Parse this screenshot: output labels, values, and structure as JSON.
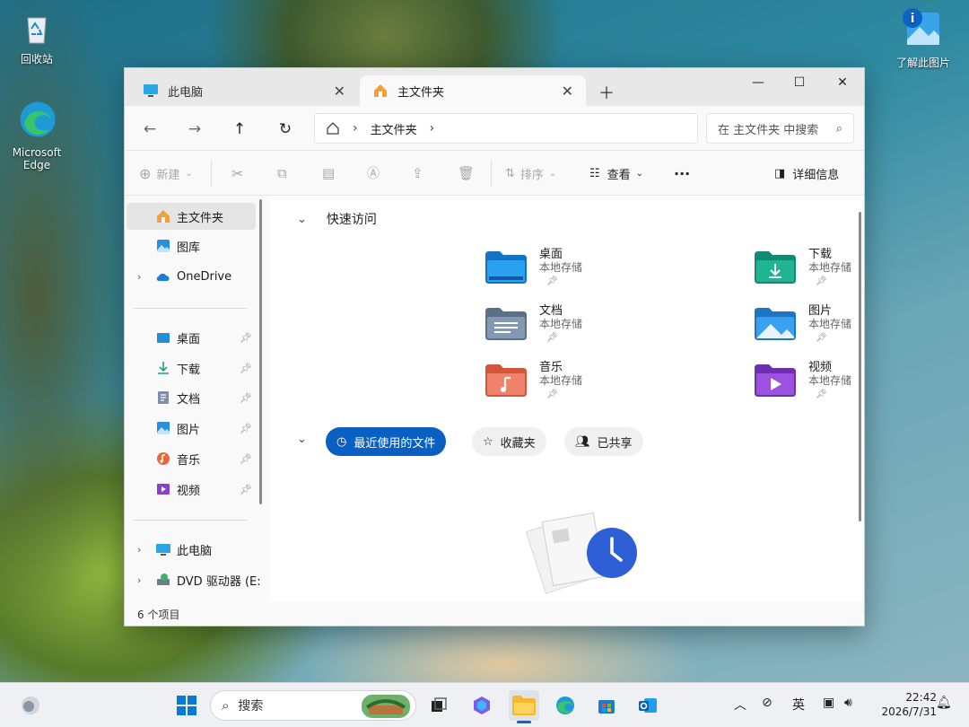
{
  "desktop": {
    "recycle_bin": "回收站",
    "edge_line1": "Microsoft",
    "edge_line2": "Edge",
    "spotlight": "了解此图片"
  },
  "window": {
    "tabs": [
      {
        "label": "此电脑",
        "icon": "monitor-icon"
      },
      {
        "label": "主文件夹",
        "icon": "home-icon"
      }
    ],
    "breadcrumb": [
      "主文件夹"
    ],
    "search_placeholder": "在 主文件夹 中搜索",
    "commands": {
      "new": "新建",
      "sort": "排序",
      "view": "查看",
      "details": "详细信息"
    },
    "sidebar": {
      "top": [
        {
          "label": "主文件夹",
          "icon": "home-icon"
        },
        {
          "label": "图库",
          "icon": "gallery-icon"
        },
        {
          "label": "OneDrive",
          "icon": "cloud-icon"
        }
      ],
      "pinned": [
        {
          "label": "桌面",
          "icon": "desktop-icon"
        },
        {
          "label": "下载",
          "icon": "download-icon"
        },
        {
          "label": "文档",
          "icon": "document-icon"
        },
        {
          "label": "图片",
          "icon": "picture-icon"
        },
        {
          "label": "音乐",
          "icon": "music-icon"
        },
        {
          "label": "视频",
          "icon": "video-icon"
        }
      ],
      "devices": [
        {
          "label": "此电脑",
          "icon": "monitor-icon"
        },
        {
          "label": "DVD 驱动器 (E:",
          "icon": "dvd-icon"
        }
      ]
    },
    "quick_access": {
      "title": "快速访问",
      "items": [
        {
          "name": "桌面",
          "sub": "本地存储",
          "color": "#1e8fd8"
        },
        {
          "name": "下载",
          "sub": "本地存储",
          "color": "#1aa58a"
        },
        {
          "name": "文档",
          "sub": "本地存储",
          "color": "#6f88a6"
        },
        {
          "name": "图片",
          "sub": "本地存储",
          "color": "#2b8fe0"
        },
        {
          "name": "音乐",
          "sub": "本地存储",
          "color": "#e8683d"
        },
        {
          "name": "视频",
          "sub": "本地存储",
          "color": "#8a3fd1"
        }
      ]
    },
    "recent_tabs": [
      "最近使用的文件",
      "收藏夹",
      "已共享"
    ],
    "status": "6 个项目"
  },
  "taskbar": {
    "search": "搜索",
    "ime": "英",
    "time": "22:42",
    "date": "2026/7/31"
  }
}
